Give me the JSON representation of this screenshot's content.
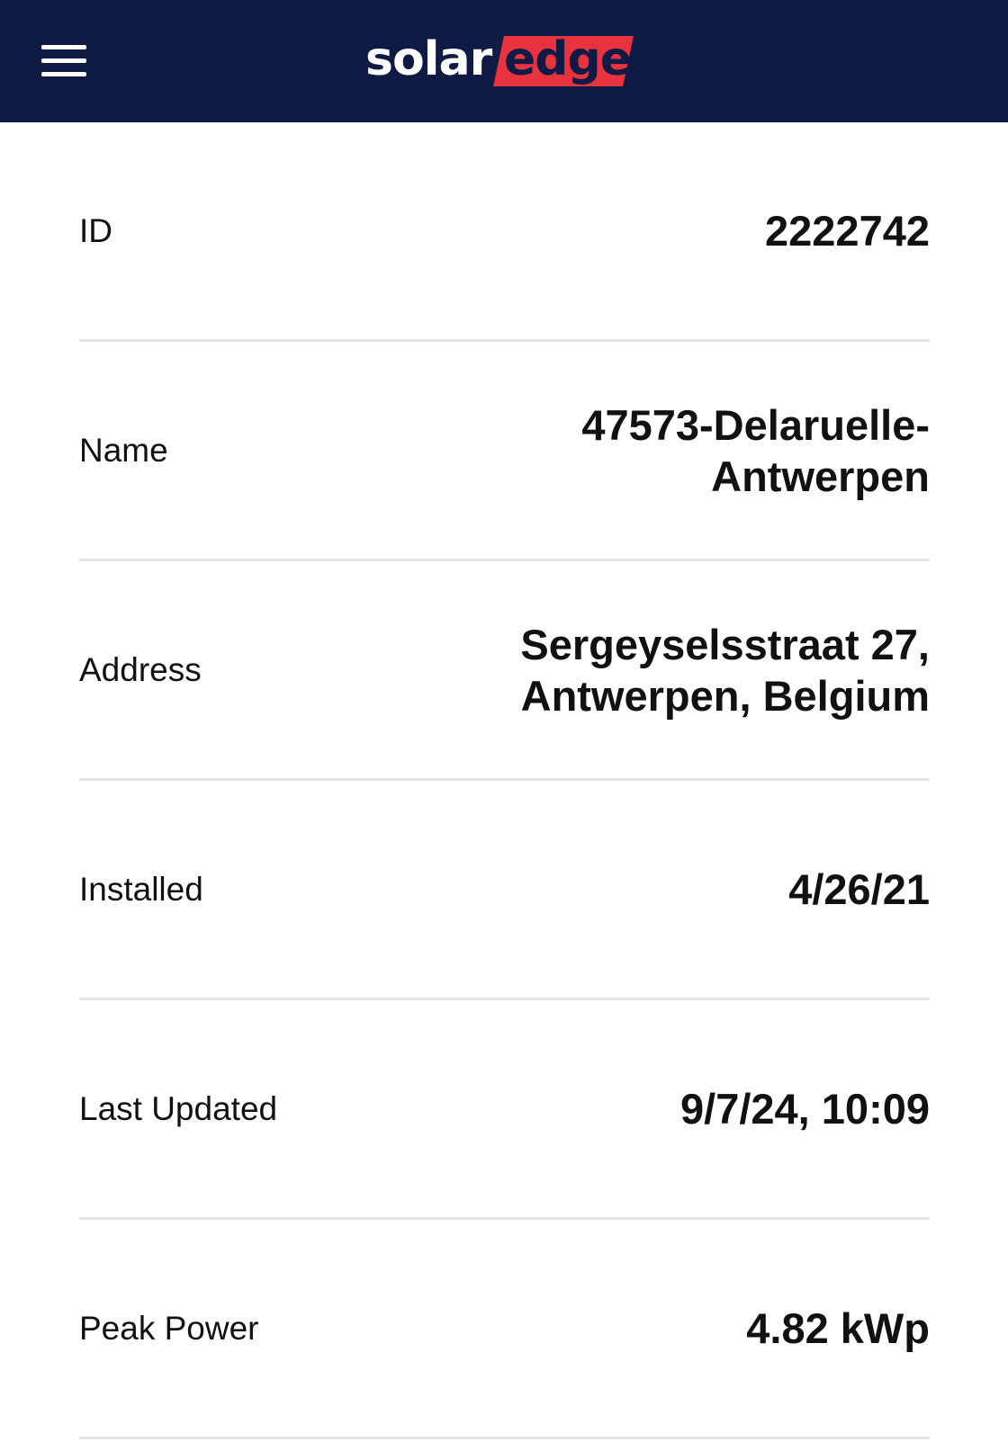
{
  "header": {
    "menu_icon": "hamburger-menu-icon",
    "logo_left": "solar",
    "logo_right": "edge",
    "background": "#0f1a45",
    "logo_accent": "#e8323e"
  },
  "details": [
    {
      "label": "ID",
      "value": "2222742"
    },
    {
      "label": "Name",
      "value": "47573-Delaruelle-Antwerpen"
    },
    {
      "label": "Address",
      "value": "Sergeyselsstraat 27, Antwerpen, Belgium"
    },
    {
      "label": "Installed",
      "value": "4/26/21"
    },
    {
      "label": "Last Updated",
      "value": "9/7/24, 10:09"
    },
    {
      "label": "Peak Power",
      "value": "4.82 kWp"
    }
  ]
}
